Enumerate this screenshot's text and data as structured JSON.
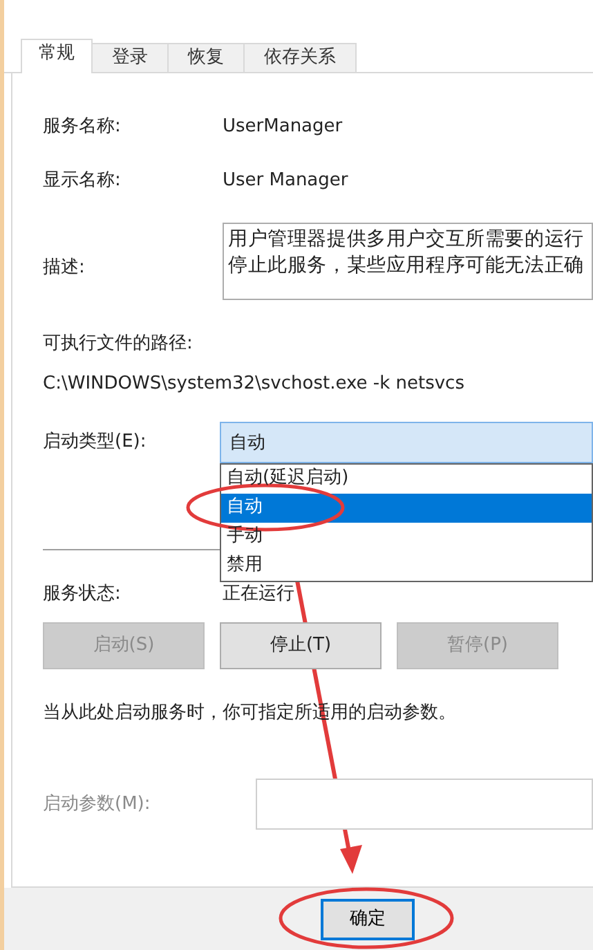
{
  "tabs": [
    {
      "label": "常规",
      "selected": true
    },
    {
      "label": "登录",
      "selected": false
    },
    {
      "label": "恢复",
      "selected": false
    },
    {
      "label": "依存关系",
      "selected": false
    }
  ],
  "fields": [
    {
      "label": "服务名称:",
      "value": "UserManager"
    },
    {
      "label": "显示名称:",
      "value": "User Manager"
    }
  ],
  "description": {
    "label": "描述:",
    "lines": [
      "用户管理器提供多用户交互所需要的运行",
      "停止此服务，某些应用程序可能无法正确"
    ]
  },
  "path": {
    "label": "可执行文件的路径:",
    "value": "C:\\WINDOWS\\system32\\svchost.exe -k netsvcs"
  },
  "startup_type": {
    "label": "启动类型(E):",
    "value": "自动",
    "expanded": true,
    "options": [
      {
        "label": "自动(延迟启动)",
        "selected": false
      },
      {
        "label": "自动",
        "selected": true
      },
      {
        "label": "手动",
        "selected": false
      },
      {
        "label": "禁用",
        "selected": false
      }
    ]
  },
  "service_status": {
    "label": "服务状态:",
    "value": "正在运行"
  },
  "service_buttons": [
    {
      "label": "启动(S)",
      "disabled": true
    },
    {
      "label": "停止(T)",
      "disabled": false
    },
    {
      "label": "暂停(P)",
      "disabled": true
    }
  ],
  "hint": "当从此处启动服务时，你可指定所适用的启动参数。",
  "start_params": {
    "label": "启动参数(M):",
    "disabled": true
  },
  "dialog_buttons": [
    {
      "label": "确定",
      "default": true
    }
  ],
  "annotations": [
    {
      "kind": "ellipse"
    },
    {
      "kind": "arrow"
    },
    {
      "kind": "ellipse"
    }
  ]
}
